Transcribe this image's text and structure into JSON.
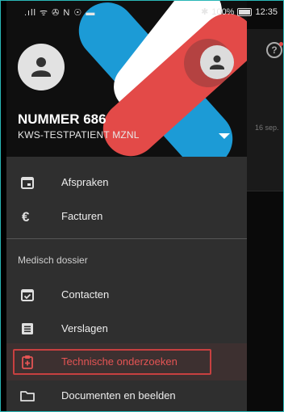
{
  "status_bar": {
    "left_icons": ".ıll ᯤ ✇ N ☉ ▬",
    "battery": "100%",
    "time": "12:35"
  },
  "background": {
    "date": "16 sep."
  },
  "header": {
    "user_name": "NUMMER 686",
    "user_subtitle": "KWS-TESTPATIENT MZNL"
  },
  "menu": {
    "items_top": [
      {
        "label": "Afspraken",
        "icon": "calendar-icon"
      },
      {
        "label": "Facturen",
        "icon": "euro-icon"
      }
    ],
    "section_title": "Medisch dossier",
    "items_medical": [
      {
        "label": "Contacten",
        "icon": "calendar-check-icon"
      },
      {
        "label": "Verslagen",
        "icon": "document-icon"
      },
      {
        "label": "Technische onderzoeken",
        "icon": "clipboard-plus-icon",
        "highlighted": true
      },
      {
        "label": "Documenten en beelden",
        "icon": "folder-icon"
      }
    ]
  },
  "colors": {
    "accent_red": "#e34a48",
    "accent_blue": "#1c9bd6",
    "highlight": "#c84040",
    "drawer_bg": "#2f2f2f"
  }
}
